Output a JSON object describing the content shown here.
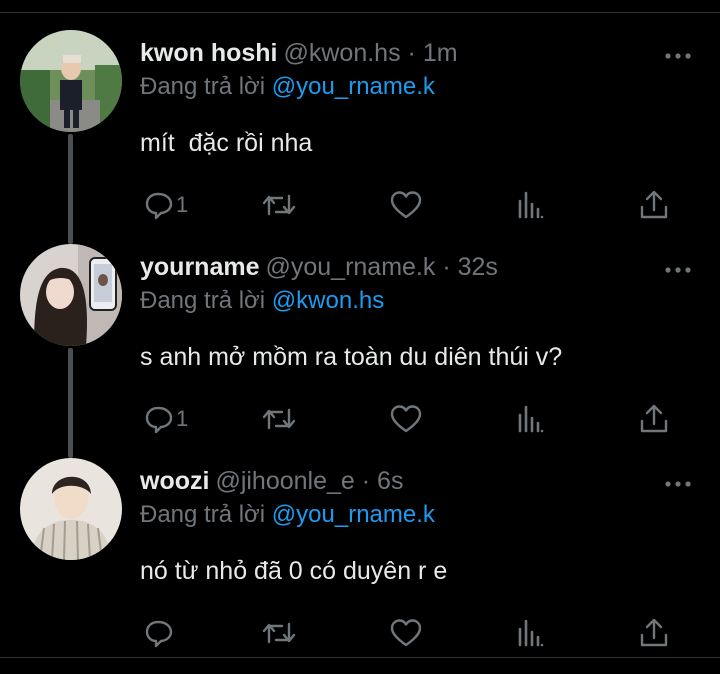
{
  "thread": {
    "tweets": [
      {
        "display_name": "kwon hoshi",
        "handle": "@kwon.hs",
        "time": "· 1m",
        "reply_prefix": "Đang trả lời",
        "reply_to": "@you_rname.k",
        "text": "mít  đặc rồi nha",
        "reply_count": "1",
        "avatar_icon": "avatar-photo"
      },
      {
        "display_name": "yourname",
        "handle": "@you_rname.k",
        "time": "· 32s",
        "reply_prefix": "Đang trả lời",
        "reply_to": "@kwon.hs",
        "text": "s anh mở mồm ra toàn du diên thúi v?",
        "reply_count": "1",
        "avatar_icon": "avatar-photo"
      },
      {
        "display_name": "woozi",
        "handle": "@jihoonle_e",
        "time": "· 6s",
        "reply_prefix": "Đang trả lời",
        "reply_to": "@you_rname.k",
        "text": "nó từ nhỏ đã 0 có duyên r e",
        "reply_count": "",
        "avatar_icon": "avatar-photo"
      }
    ]
  },
  "colors": {
    "background": "#000000",
    "text_primary": "#e7e9ea",
    "text_secondary": "#71767b",
    "accent": "#1d9bf0",
    "divider": "#2f3336"
  },
  "icons": [
    "reply-icon",
    "retweet-icon",
    "like-icon",
    "views-icon",
    "share-icon",
    "more-icon"
  ]
}
